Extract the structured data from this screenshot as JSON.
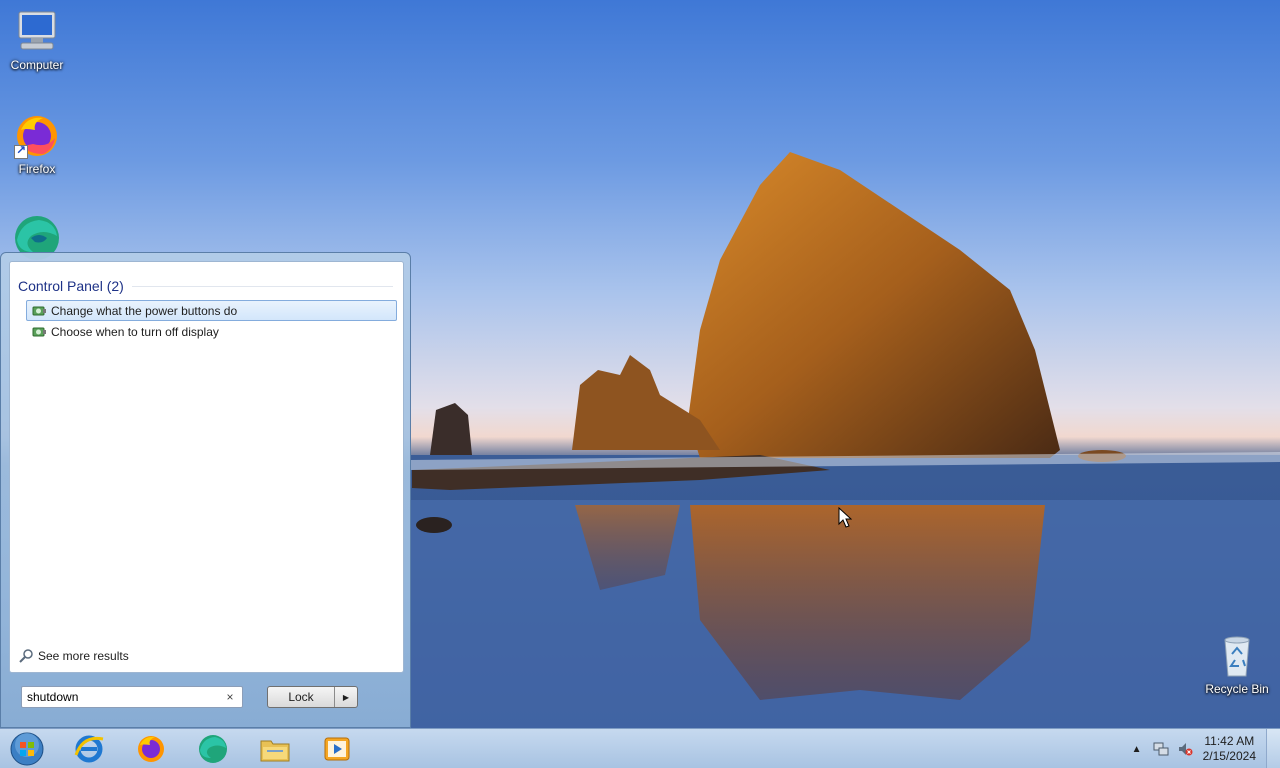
{
  "desktop": {
    "icons": [
      {
        "label": "Computer",
        "icon": "computer-icon"
      },
      {
        "label": "Firefox",
        "icon": "firefox-icon"
      },
      {
        "label": "",
        "icon": "edge-icon"
      },
      {
        "label": "Recycle Bin",
        "icon": "recycle-bin-icon"
      }
    ]
  },
  "start_menu": {
    "section_title": "Control Panel (2)",
    "results": [
      {
        "label": "Change what the power buttons do",
        "selected": true,
        "icon": "power-options-icon"
      },
      {
        "label": "Choose when to turn off display",
        "selected": false,
        "icon": "power-options-icon"
      }
    ],
    "see_more": "See more results",
    "search": {
      "value": "shutdown",
      "clear_symbol": "×"
    },
    "power_button": {
      "label": "Lock",
      "arrow": "▶"
    }
  },
  "taskbar": {
    "pinned": [
      "start-orb",
      "internet-explorer",
      "firefox",
      "edge",
      "file-explorer",
      "media-player"
    ],
    "clock": {
      "time": "11:42 AM",
      "date": "2/15/2024"
    },
    "tray_expand_symbol": "▲"
  },
  "colors": {
    "accent": "#1e3287",
    "selection_border": "#84acdd",
    "selection_fill": "#d3e6fb",
    "taskbar": "#b7cfe9"
  }
}
